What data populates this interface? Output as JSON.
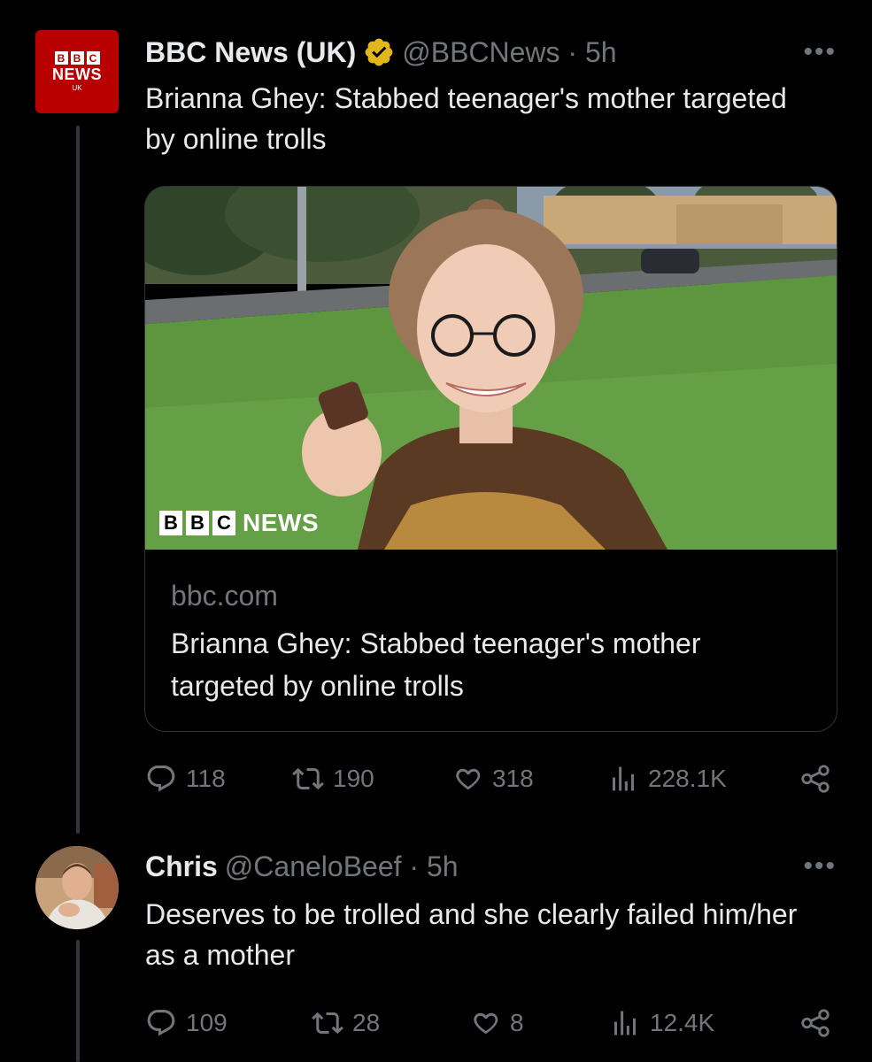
{
  "tweet1": {
    "avatar": {
      "logo_letters": [
        "B",
        "B",
        "C"
      ],
      "news": "NEWS",
      "region": "UK"
    },
    "display_name": "BBC News (UK)",
    "verified_icon": "gold-verified-badge-icon",
    "handle_time": "@BBCNews · 5h",
    "text": "Brianna Ghey: Stabbed teenager's mother targeted by online trolls",
    "card": {
      "image_logo_letters": [
        "B",
        "B",
        "C"
      ],
      "image_logo_word": "NEWS",
      "domain": "bbc.com",
      "title": "Brianna Ghey: Stabbed teenager's mother targeted by online trolls"
    },
    "stats": {
      "replies": "118",
      "reposts": "190",
      "likes": "318",
      "views": "228.1K"
    }
  },
  "tweet2": {
    "display_name": "Chris",
    "handle_time": "@CaneloBeef · 5h",
    "text": "Deserves to be trolled and she clearly failed him/her as a mother",
    "stats": {
      "replies": "109",
      "reposts": "28",
      "likes": "8",
      "views": "12.4K"
    }
  },
  "icons": {
    "more": "more-horizontal-icon",
    "reply": "reply-bubble-icon",
    "repost": "repost-arrows-icon",
    "like": "heart-icon",
    "views": "views-bars-icon",
    "share": "share-icon"
  },
  "colors": {
    "background": "#000000",
    "text_primary": "#e7e9ea",
    "text_secondary": "#71767b",
    "border": "#2f3336",
    "bbc_red": "#b80000",
    "verified_gold": "#e2b719"
  }
}
